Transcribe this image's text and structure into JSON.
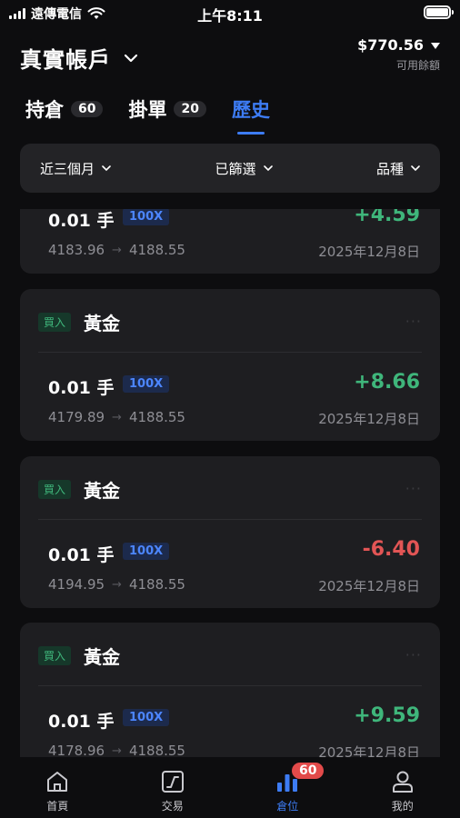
{
  "status_bar": {
    "carrier": "遠傳電信",
    "time": "上午8:11"
  },
  "header": {
    "account_title": "真實帳戶",
    "balance": "$770.56",
    "balance_label": "可用餘額"
  },
  "tabs": [
    {
      "label": "持倉",
      "count": "60"
    },
    {
      "label": "掛單",
      "count": "20"
    },
    {
      "label": "歷史",
      "count": ""
    }
  ],
  "filters": {
    "period": "近三個月",
    "filtered": "已篩選",
    "instrument": "品種"
  },
  "trades": [
    {
      "side": "",
      "symbol": "",
      "lots": "0.01 手",
      "leverage": "100X",
      "pnl": "+4.59",
      "pnl_direction": "positive",
      "open_price": "4183.96",
      "close_price": "4188.55",
      "date": "2025年12月8日"
    },
    {
      "side": "買入",
      "symbol": "黃金",
      "lots": "0.01 手",
      "leverage": "100X",
      "pnl": "+8.66",
      "pnl_direction": "positive",
      "open_price": "4179.89",
      "close_price": "4188.55",
      "date": "2025年12月8日"
    },
    {
      "side": "買入",
      "symbol": "黃金",
      "lots": "0.01 手",
      "leverage": "100X",
      "pnl": "-6.40",
      "pnl_direction": "negative",
      "open_price": "4194.95",
      "close_price": "4188.55",
      "date": "2025年12月8日"
    },
    {
      "side": "買入",
      "symbol": "黃金",
      "lots": "0.01 手",
      "leverage": "100X",
      "pnl": "+9.59",
      "pnl_direction": "positive",
      "open_price": "4178.96",
      "close_price": "4188.55",
      "date": "2025年12月8日"
    }
  ],
  "bottom_nav": [
    {
      "label": "首頁",
      "icon": "home-icon"
    },
    {
      "label": "交易",
      "icon": "chart-icon"
    },
    {
      "label": "倉位",
      "icon": "bar-chart-icon",
      "badge": "60"
    },
    {
      "label": "我的",
      "icon": "profile-icon"
    }
  ],
  "colors": {
    "accent": "#3d7cf4",
    "positive": "#3fb67b",
    "negative": "#e25555",
    "card": "#1e1e21",
    "background": "#0d0d0f"
  }
}
